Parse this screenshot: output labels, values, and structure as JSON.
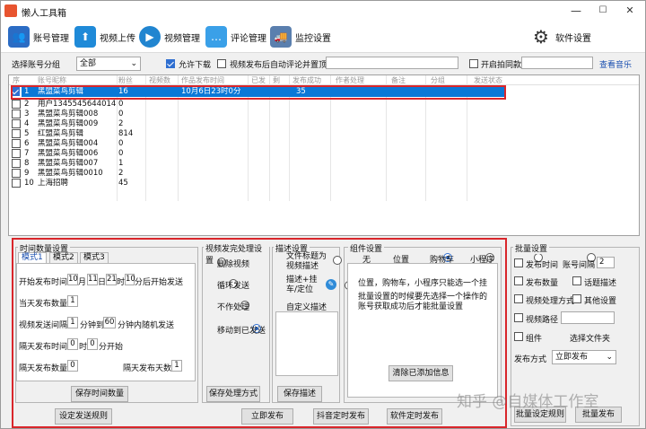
{
  "window": {
    "title": "懒人工具箱",
    "min": "—",
    "max": "☐",
    "close": "✕"
  },
  "toolbar": {
    "items": [
      {
        "label": "账号管理",
        "icon": "accounts-icon",
        "color": "#2b6cc4"
      },
      {
        "label": "视频上传",
        "icon": "upload-icon",
        "color": "#1f8ad8"
      },
      {
        "label": "视频管理",
        "icon": "video-icon",
        "color": "#2185d0"
      },
      {
        "label": "评论管理",
        "icon": "comment-icon",
        "color": "#3aa0e8"
      },
      {
        "label": "监控设置",
        "icon": "truck-icon",
        "color": "#5a7fae"
      }
    ],
    "settings": "软件设置"
  },
  "filter": {
    "group_label": "选择账号分组",
    "group_value": "全部",
    "allow_download": "允许下载",
    "auto_comment": "视频发布后自动评论并置顶",
    "auto_comment_value": "",
    "shoot_same": "开启拍同款",
    "shoot_same_value": "",
    "view_music": "查看音乐"
  },
  "grid": {
    "headers": [
      "序",
      "账号昵称",
      "粉丝",
      "视频数",
      "作品发布时间",
      "已发",
      "剩",
      "发布成功",
      "作者处理",
      "备注",
      "分组",
      "发送状态"
    ],
    "rows": [
      {
        "idx": "1",
        "name": "黑盟菜鸟剪辑",
        "fans": "16",
        "time": "10月6日23时0分",
        "sent": "35",
        "checked": true,
        "selected": true
      },
      {
        "idx": "2",
        "name": "用户1345545644014",
        "fans": "0",
        "checked": false
      },
      {
        "idx": "3",
        "name": "黑盟菜鸟剪辑008",
        "fans": "0",
        "checked": false
      },
      {
        "idx": "4",
        "name": "黑盟菜鸟剪辑009",
        "fans": "2",
        "checked": false
      },
      {
        "idx": "5",
        "name": "红盟菜鸟剪辑",
        "fans": "814",
        "checked": false
      },
      {
        "idx": "6",
        "name": "黑盟菜鸟剪辑004",
        "fans": "0",
        "checked": false
      },
      {
        "idx": "7",
        "name": "黑盟菜鸟剪辑006",
        "fans": "0",
        "checked": false
      },
      {
        "idx": "8",
        "name": "黑盟菜鸟剪辑007",
        "fans": "1",
        "checked": false
      },
      {
        "idx": "9",
        "name": "黑盟菜鸟剪辑0010",
        "fans": "2",
        "checked": false
      },
      {
        "idx": "10",
        "name": "上海招聘",
        "fans": "45",
        "checked": false
      }
    ]
  },
  "time_settings": {
    "title": "时间数量设置",
    "tabs": [
      "模式1",
      "模式2",
      "模式3"
    ],
    "start_label": "开始发布时间",
    "month": "10",
    "month_u": "月",
    "day": "11",
    "day_u": "日",
    "hour": "21",
    "hour_u": "时",
    "min": "10",
    "min_u": "分后开始发送",
    "daily_label": "当天发布数量",
    "daily": "1",
    "interval_label": "视频发送间隔",
    "interval_a": "1",
    "interval_mid": "分钟到",
    "interval_b": "60",
    "interval_end": "分钟内随机发送",
    "next_time_label": "隔天发布时间",
    "next_h": "0",
    "next_h_u": "时",
    "next_m": "0",
    "next_m_u": "分开始",
    "next_count_label": "隔天发布数量",
    "next_count": "0",
    "next_days_label": "隔天发布天数",
    "next_days": "1",
    "save": "保存时间数量"
  },
  "after": {
    "title": "视频发完处理设置",
    "options": [
      "删除视频",
      "循环发送",
      "不作处理",
      "移动到已发送"
    ],
    "selected": 3,
    "save": "保存处理方式"
  },
  "desc": {
    "title": "描述设置",
    "options": [
      "文件标题为视频描述",
      "描述+挂车/定位",
      "自定义描述"
    ],
    "selected": 2,
    "save": "保存描述"
  },
  "component": {
    "title": "组件设置",
    "options": [
      "无",
      "位置",
      "购物车",
      "小程序"
    ],
    "selected": 0,
    "note1": "位置，购物车，小程序只能选一个挂",
    "note2": "批量设置的时候要先选择一个操作的账号获取成功后才能批量设置",
    "clear": "清除已添加信息"
  },
  "batch": {
    "title": "批量设置",
    "publish_time": "发布时间",
    "account_interval": "账号间隔",
    "interval": "2",
    "count": "发布数量",
    "topic": "话题描述",
    "process": "视频处理方式",
    "other": "其他设置",
    "path": "视频路径",
    "component": "组件",
    "choose_folder": "选择文件夹",
    "publish_mode_label": "发布方式",
    "publish_mode": "立即发布",
    "save": "批量设定规则",
    "publish": "批量发布"
  },
  "bottom": {
    "rules": "设定发送规则",
    "now": "立即发布",
    "douyin_timed": "抖音定时发布",
    "software_timed": "软件定时发布"
  },
  "watermark": "知乎 @自媒体工作室"
}
